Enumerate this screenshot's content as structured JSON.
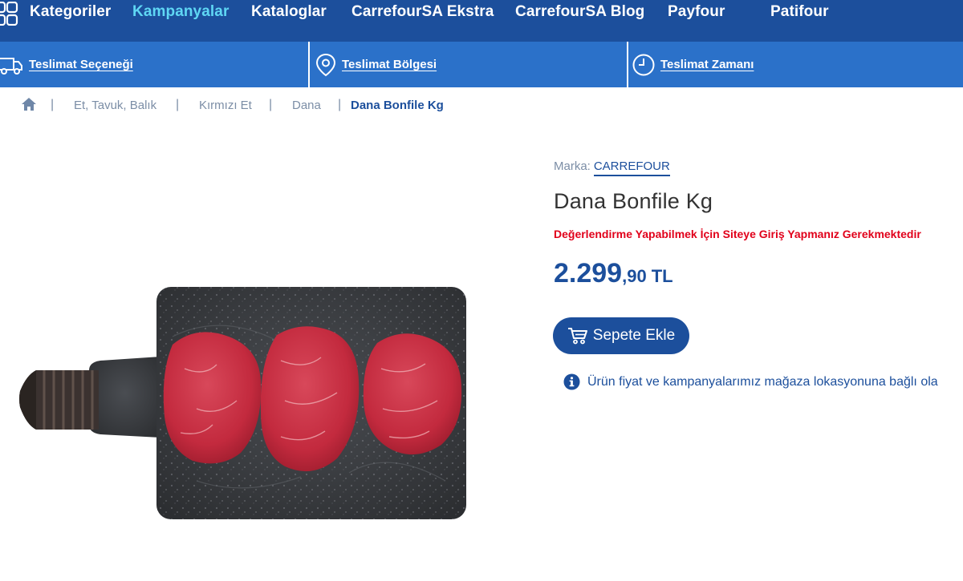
{
  "topnav": {
    "items": [
      {
        "label": "Kategoriler",
        "active": false
      },
      {
        "label": "Kampanyalar",
        "active": true
      },
      {
        "label": "Kataloglar",
        "active": false
      },
      {
        "label": "CarrefourSA Ekstra",
        "active": false
      },
      {
        "label": "CarrefourSA Blog",
        "active": false
      },
      {
        "label": "Payfour",
        "active": false
      },
      {
        "label": "Patifour",
        "active": false
      }
    ],
    "active_color": "#5fd7f4",
    "background": "#1c4f9c"
  },
  "delivery": {
    "background": "#2b71c9",
    "options": [
      {
        "label": "Teslimat Seçeneği",
        "icon": "truck-icon"
      },
      {
        "label": "Teslimat Bölgesi",
        "icon": "location-pin-icon"
      },
      {
        "label": "Teslimat Zamanı",
        "icon": "clock-icon"
      }
    ]
  },
  "breadcrumb": {
    "home_icon": "home-icon",
    "items": [
      "Et, Tavuk, Balık",
      "Kırmızı Et",
      "Dana"
    ],
    "current": "Dana Bonfile Kg"
  },
  "product": {
    "brand_label": "Marka:",
    "brand": "CARREFOUR",
    "title": "Dana Bonfile Kg",
    "rating_warning": "Değerlendirme Yapabilmek İçin Siteye Giriş Yapmanız Gerekmektedir",
    "price_integer": "2.299",
    "price_decimal": ",90",
    "currency": "TL",
    "add_to_cart": "Sepete Ekle",
    "info_text": "Ürün fiyat ve kampanyalarımız mağaza lokasyonuna bağlı ola",
    "warning_color": "#e1001a",
    "accent_color": "#1c4f9c"
  }
}
